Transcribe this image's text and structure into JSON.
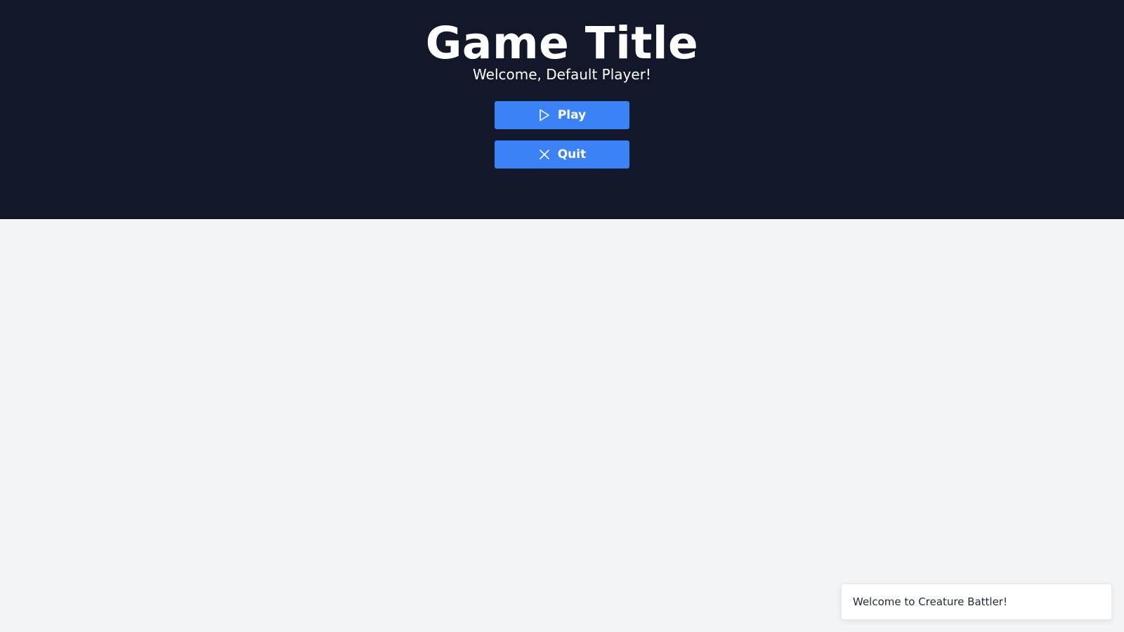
{
  "header": {
    "title": "Game Title",
    "welcome": "Welcome, Default Player!"
  },
  "menu": {
    "play_label": "Play",
    "play_icon": "play-icon",
    "quit_label": "Quit",
    "quit_icon": "close-icon"
  },
  "toast": {
    "message": "Welcome to Creature Battler!"
  },
  "colors": {
    "header_background": "#121829",
    "page_background": "#f3f4f6",
    "button_background": "#3b82f6",
    "text_light": "#ffffff"
  }
}
